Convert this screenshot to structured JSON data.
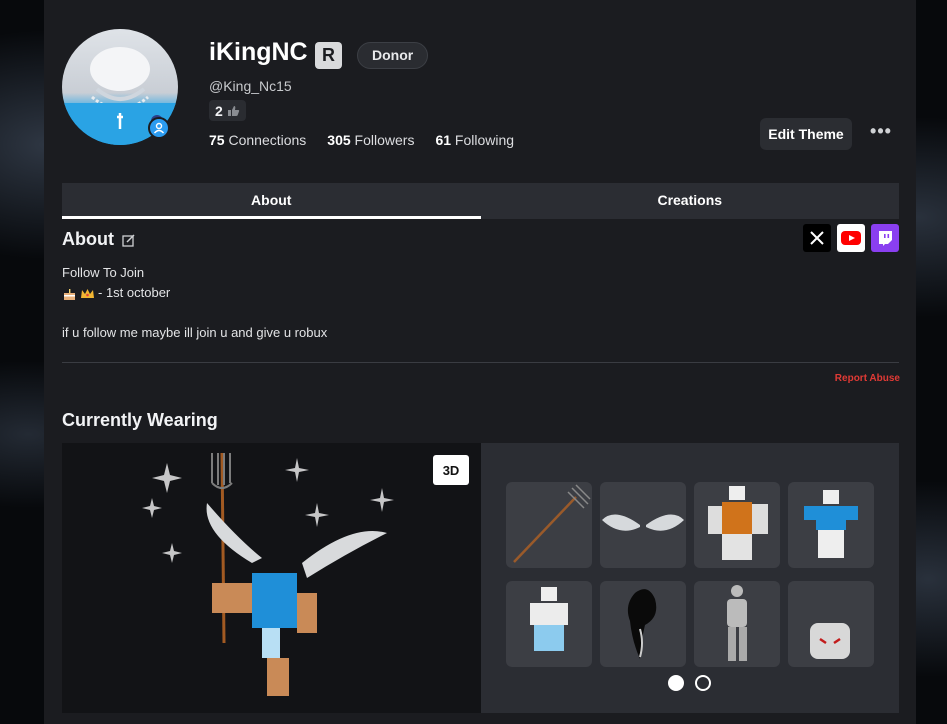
{
  "profile": {
    "display_name": "iKingNC",
    "premium_glyph": "R",
    "donor_label": "Donor",
    "username": "@King_Nc15",
    "level": "2",
    "connections_count": "75",
    "connections_label": "Connections",
    "followers_count": "305",
    "followers_label": "Followers",
    "following_count": "61",
    "following_label": "Following",
    "edit_theme_label": "Edit Theme",
    "more_label": "•••"
  },
  "tabs": [
    {
      "label": "About",
      "active": true
    },
    {
      "label": "Creations",
      "active": false
    }
  ],
  "about": {
    "title": "About",
    "line1": "Follow To Join",
    "line2": "- 1st october",
    "line3": "if u follow me maybe ill join u and give u robux",
    "report_label": "Report Abuse",
    "socials": [
      "x-icon",
      "youtube-icon",
      "twitch-icon"
    ]
  },
  "wearing": {
    "title": "Currently Wearing",
    "view_mode_label": "3D",
    "items": [
      "pitchfork",
      "angel-wings",
      "orange-outfit",
      "blue-shirt",
      "blue-pants",
      "black-flame",
      "plain-body",
      "white-head"
    ],
    "page_count": 2,
    "active_page": 1
  },
  "colors": {
    "panel": "#1b1c20",
    "tab_bar": "#2b2d33",
    "accent_blue": "#2b9bf0",
    "report_red": "#e03a35"
  }
}
